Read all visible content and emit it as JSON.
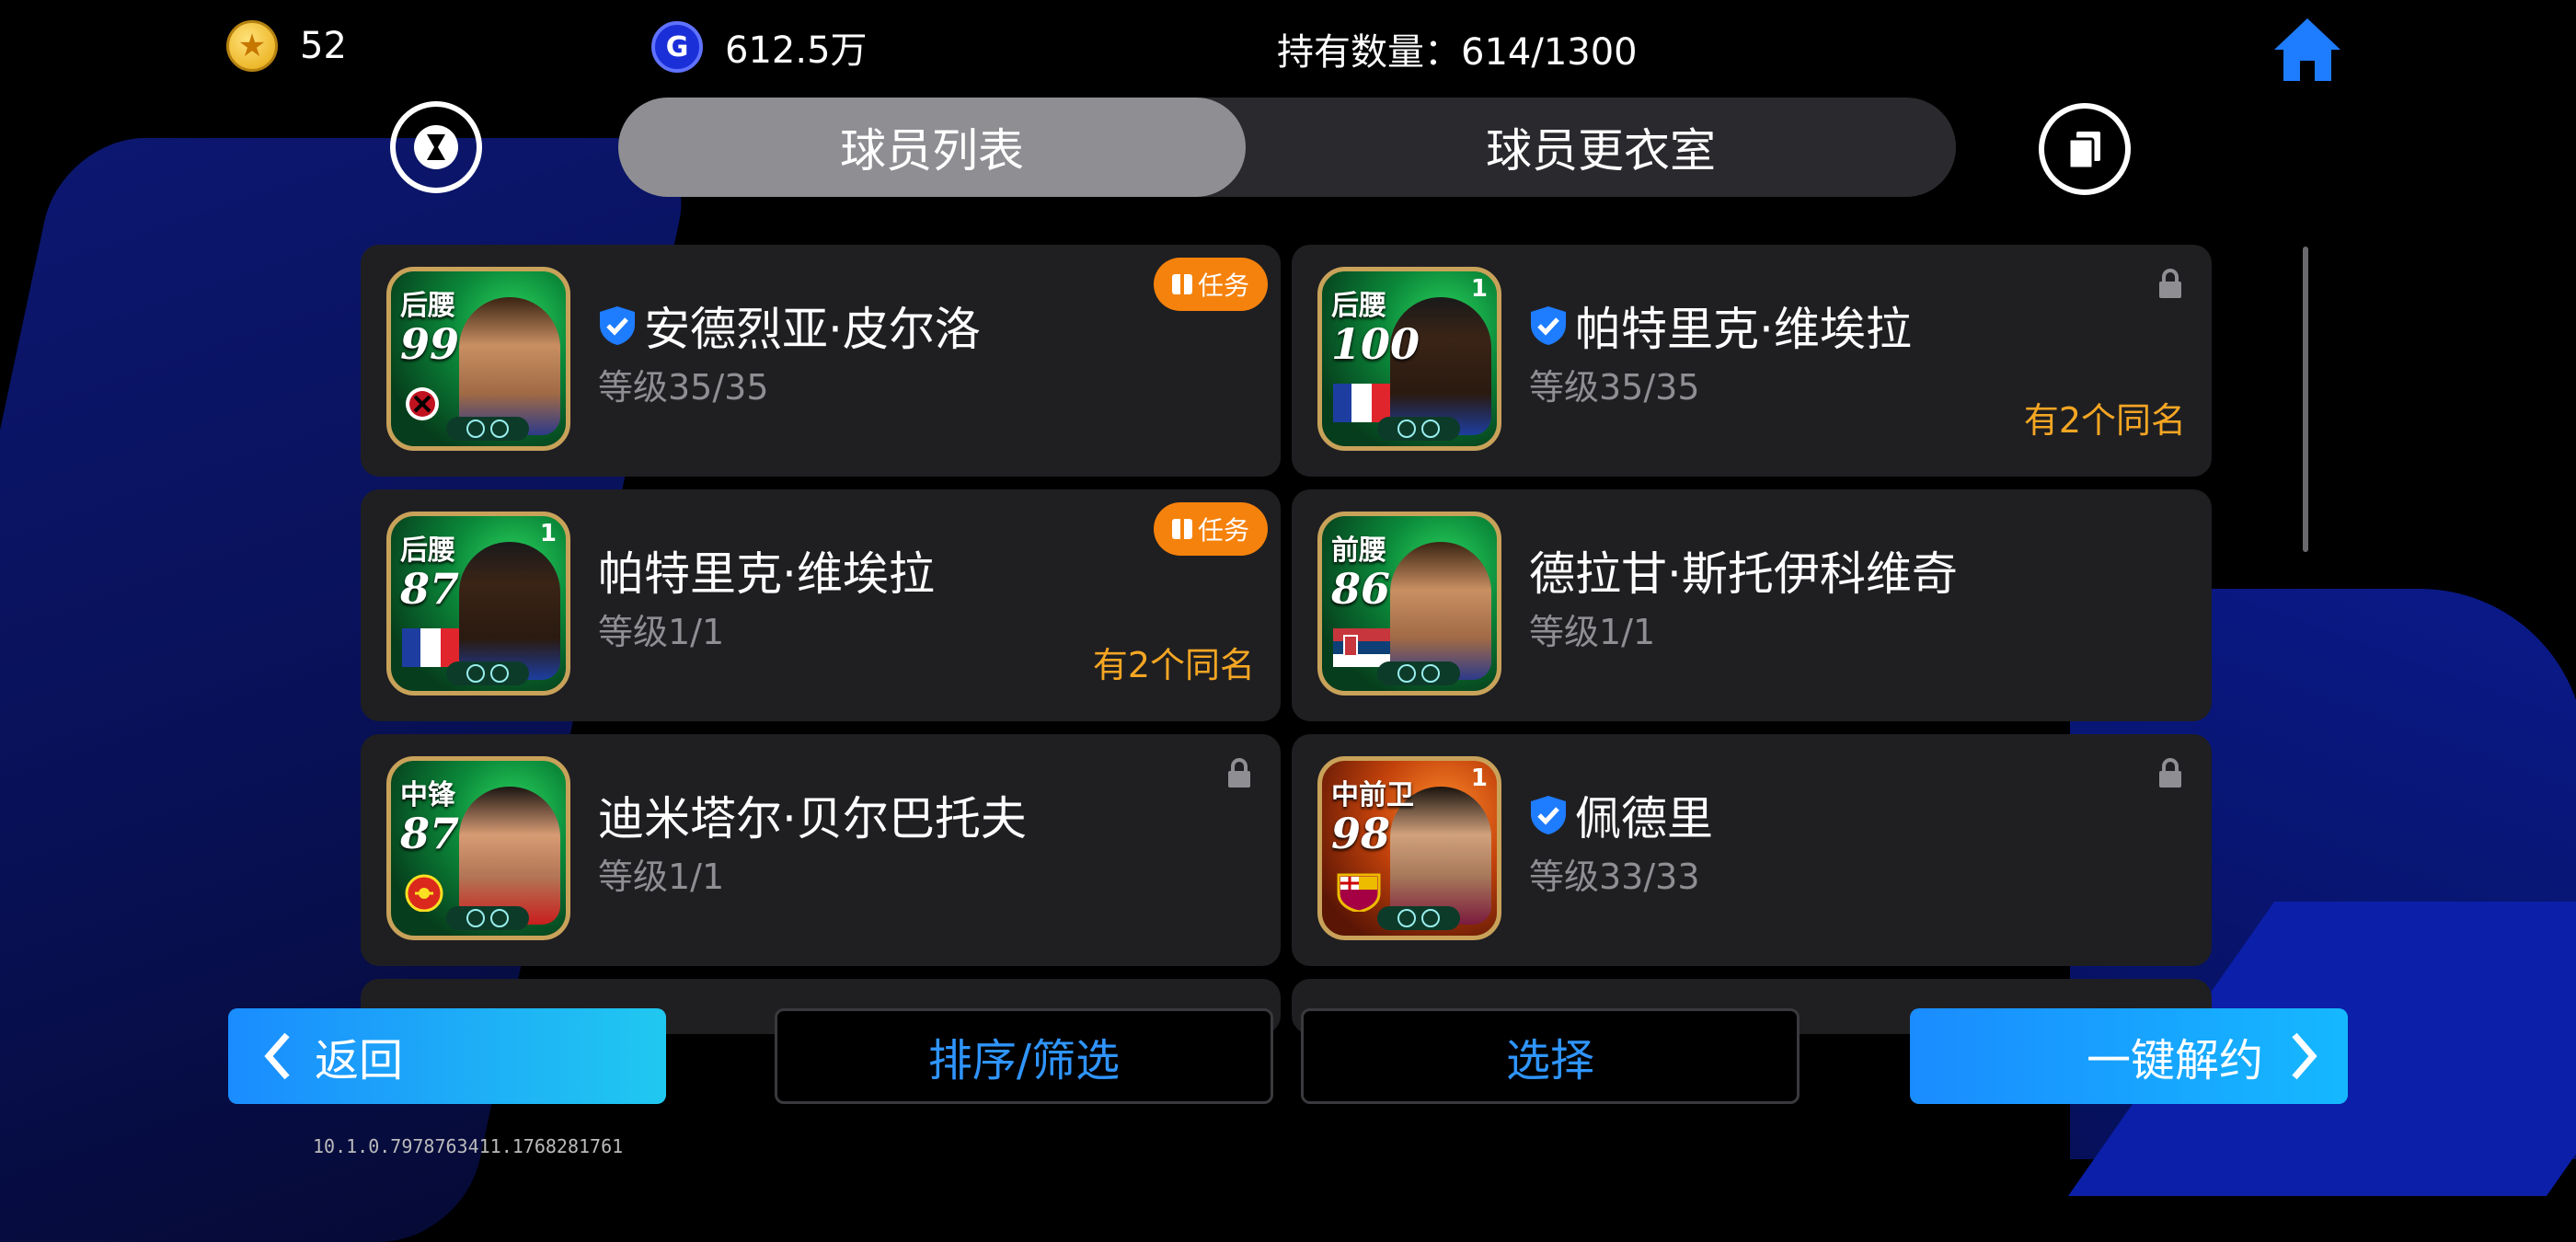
{
  "currency": {
    "coins": "52",
    "gp": "612.5万",
    "gp_symbol": "G"
  },
  "holdings": {
    "label": "持有数量：614/1300"
  },
  "tabs": [
    {
      "label": "球员列表",
      "active": true
    },
    {
      "label": "球员更衣室",
      "active": false
    }
  ],
  "players": [
    {
      "position": "后腰",
      "rating": "99",
      "name": "安德烈亚·皮尔洛",
      "level": "等级35/35",
      "verified": true,
      "task": true,
      "locked": false,
      "same_name": "",
      "card_color": "green",
      "badge_one": false,
      "crest": "milan-crest"
    },
    {
      "position": "后腰",
      "rating": "100",
      "name": "帕特里克·维埃拉",
      "level": "等级35/35",
      "verified": true,
      "task": false,
      "locked": true,
      "same_name": "有2个同名",
      "card_color": "green",
      "badge_one": true,
      "flag": "france-flag"
    },
    {
      "position": "后腰",
      "rating": "87",
      "name": "帕特里克·维埃拉",
      "level": "等级1/1",
      "verified": false,
      "task": true,
      "locked": false,
      "same_name": "有2个同名",
      "card_color": "green",
      "badge_one": true,
      "flag": "france-flag"
    },
    {
      "position": "前腰",
      "rating": "86",
      "name": "德拉甘·斯托伊科维奇",
      "level": "等级1/1",
      "verified": false,
      "task": false,
      "locked": false,
      "same_name": "",
      "card_color": "green",
      "badge_one": false,
      "flag": "serbia-flag"
    },
    {
      "position": "中锋",
      "rating": "87",
      "name": "迪米塔尔·贝尔巴托夫",
      "level": "等级1/1",
      "verified": false,
      "task": false,
      "locked": true,
      "same_name": "",
      "card_color": "green",
      "badge_one": false,
      "crest": "man-utd-crest"
    },
    {
      "position": "中前卫",
      "rating": "98",
      "name": "佩德里",
      "level": "等级33/33",
      "verified": true,
      "task": false,
      "locked": true,
      "same_name": "",
      "card_color": "orange",
      "badge_one": true,
      "crest": "barcelona-crest"
    }
  ],
  "task_label": "任务",
  "buttons": {
    "back": "返回",
    "sort_filter": "排序/筛选",
    "select": "选择",
    "release": "一键解约"
  },
  "version": "10.1.0.7978763411.1768281761",
  "colors": {
    "accent_blue": "#1a8cff",
    "orange": "#f5820c",
    "same_name": "#f5a623"
  }
}
